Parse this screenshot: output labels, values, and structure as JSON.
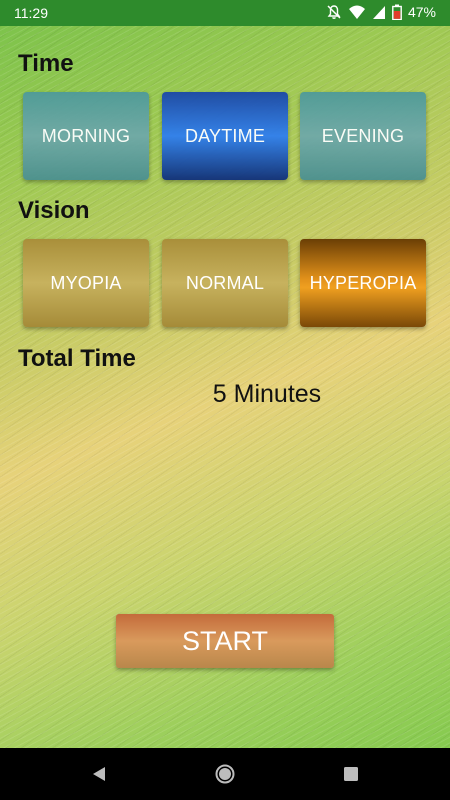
{
  "status_bar": {
    "time": "11:29",
    "battery": "47%",
    "icons": [
      "notifications-off-icon",
      "wifi-icon",
      "signal-icon",
      "battery-icon"
    ]
  },
  "time_section": {
    "label": "Time",
    "options": [
      {
        "label": "MORNING",
        "selected": false
      },
      {
        "label": "DAYTIME",
        "selected": true
      },
      {
        "label": "EVENING",
        "selected": false
      }
    ]
  },
  "vision_section": {
    "label": "Vision",
    "options": [
      {
        "label": "MYOPIA",
        "selected": false
      },
      {
        "label": "NORMAL",
        "selected": false
      },
      {
        "label": "HYPEROPIA",
        "selected": true
      }
    ]
  },
  "total_time": {
    "label": "Total Time",
    "value": "5 Minutes"
  },
  "start_button": {
    "label": "START"
  },
  "nav_bar": {
    "buttons": [
      "back-icon",
      "home-icon",
      "recents-icon"
    ]
  },
  "colors": {
    "status_bar": "#2e8b2c",
    "time_selected": "#2f7ff0",
    "vision_selected": "#e0901a",
    "start": "#d99a5c"
  }
}
